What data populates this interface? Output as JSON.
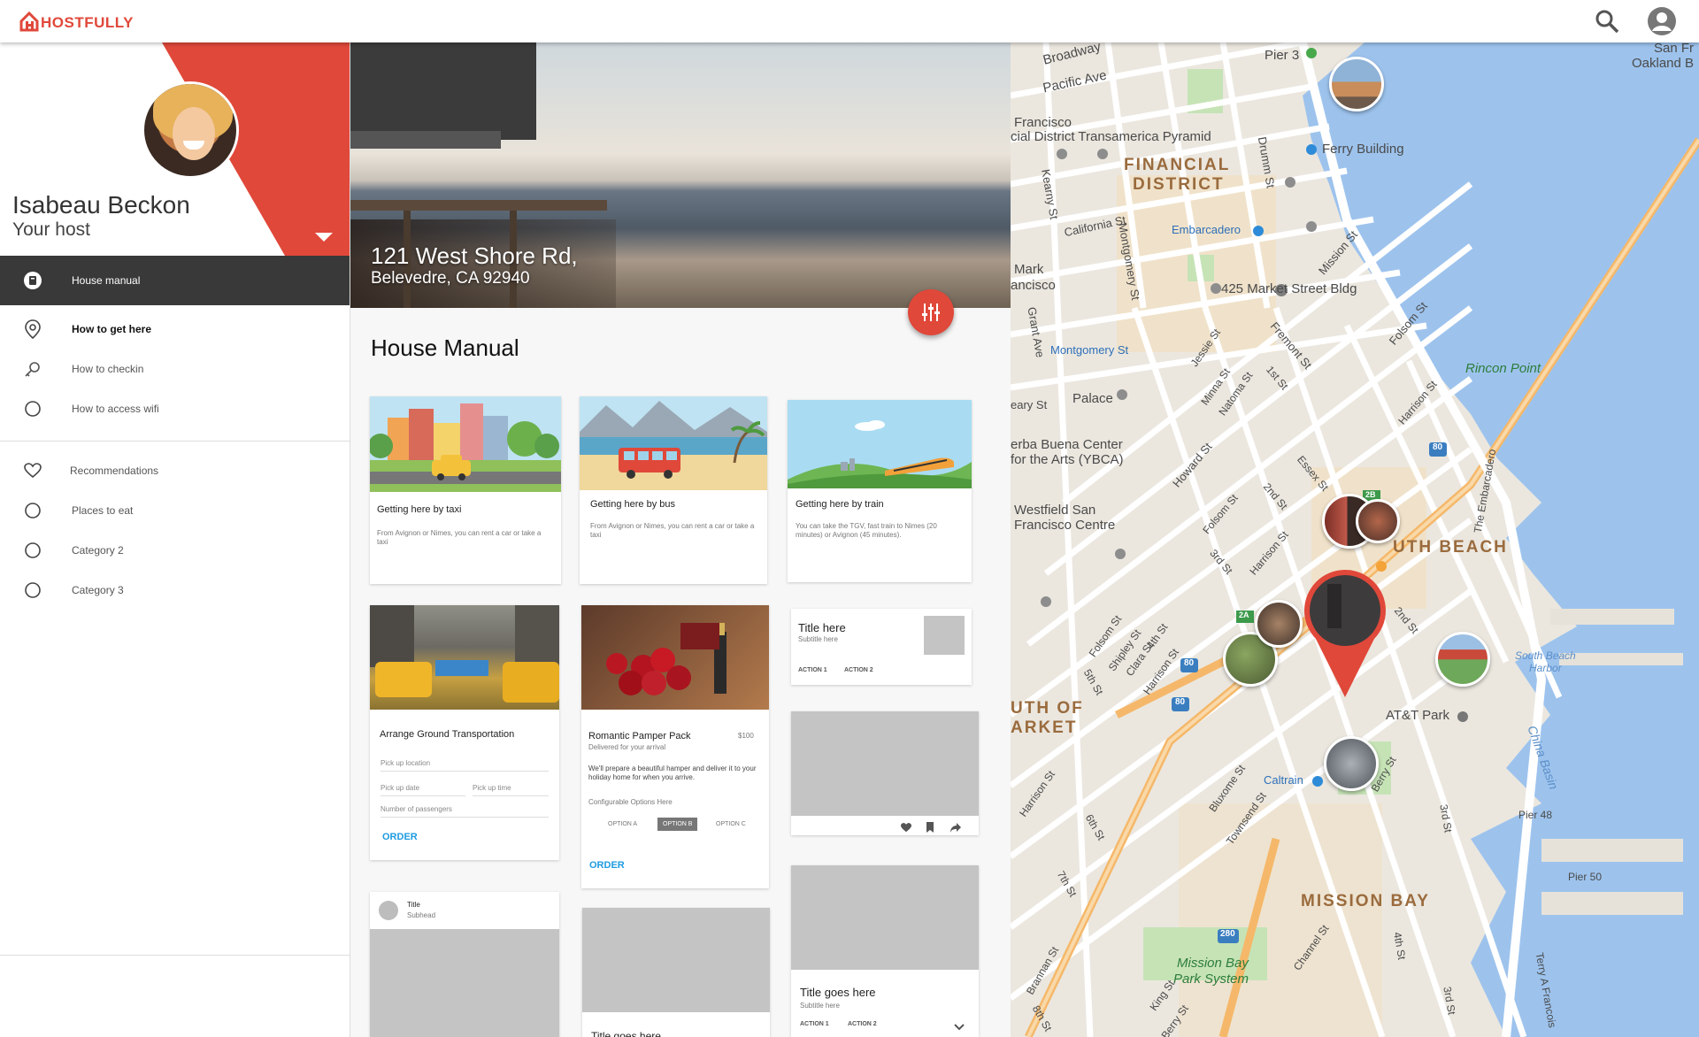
{
  "app": {
    "brand": "HOSTFULLY"
  },
  "host": {
    "name": "Isabeau Beckon",
    "role": "Your host"
  },
  "nav": {
    "items": [
      {
        "label": "House manual"
      },
      {
        "label": "How to get here"
      },
      {
        "label": "How to checkin"
      },
      {
        "label": "How to access wifi"
      },
      {
        "label": "Recommendations"
      },
      {
        "label": "Places to eat"
      },
      {
        "label": "Category 2"
      },
      {
        "label": "Category 3"
      }
    ]
  },
  "hero": {
    "address_line1": "121 West Shore Rd,",
    "address_line2": "Belevedre, CA 92940"
  },
  "main": {
    "section_title": "House Manual"
  },
  "cards": {
    "taxi": {
      "title": "Getting here by taxi",
      "text": "From Avignon or Nimes, you can rent a car or take a taxi"
    },
    "bus": {
      "title": "Getting here by bus",
      "text": "From Avignon or Nimes, you can rent a car or take a taxi"
    },
    "train": {
      "title": "Getting here by train",
      "text": "You can take the TGV, fast train to Nimes (20 minutes) or Avignon (45 minutes)."
    },
    "ground": {
      "title": "Arrange Ground Transportation",
      "pickup_location": "Pick up location",
      "pickup_date": "Pick up date",
      "pickup_time": "Pick up time",
      "passengers": "Number of passengers",
      "order": "ORDER"
    },
    "pamper": {
      "title": "Romantic Pamper Pack",
      "price": "$100",
      "subtitle": "Delivered for your arrival",
      "text": "We'll prepare a beautiful hamper and deliver it to your holiday home for when you arrive.",
      "options_label": "Configurable Options Here",
      "options": [
        "OPTION A",
        "OPTION B",
        "OPTION C"
      ],
      "order": "ORDER"
    },
    "template1": {
      "title": "Title here",
      "subtitle": "Subtitle here",
      "action1": "ACTION 1",
      "action2": "ACTION 2"
    },
    "avatar_card": {
      "title": "Title",
      "subhead": "Subhead"
    },
    "bottom_mid": {
      "title": "Title goes here"
    },
    "template2": {
      "title": "Title goes here",
      "subtitle": "Subtitle here",
      "action1": "ACTION 1",
      "action2": "ACTION 2"
    }
  },
  "map": {
    "labels": {
      "broadway": "Broadway",
      "pacific_ave": "Pacific Ave",
      "pier3": "Pier 3",
      "oakland": "San Fr\nOakland B",
      "francisco": "Francisco",
      "transamerica": "cial District Transamerica Pyramid",
      "ferry": "Ferry Building",
      "financial": "FINANCIAL",
      "district": "DISTRICT",
      "drumm": "Drumm St",
      "california": "California St",
      "embarcadero": "Embarcadero",
      "kearny": "Kearny St",
      "mark": "Mark",
      "ancisco": "ancisco",
      "market425": "425 Market Street Bldg",
      "mission_st": "Mission St",
      "montgomery": "Montgomery St",
      "montgomery_st2": "Montgomery St",
      "grant": "Grant Ave",
      "fremont": "Fremont St",
      "folsom1": "Folsom St",
      "rincon": "Rincon Point",
      "palace": "Palace",
      "eary": "eary St",
      "jessie": "Jessie St",
      "minna": "Minna St",
      "natoma": "Natoma St",
      "first": "1st St",
      "harrison1": "Harrison St",
      "yerba1": "erba Buena Center",
      "yerba2": "for the Arts (YBCA)",
      "howard": "Howard St",
      "essex": "Essex St",
      "embarcadero_rd": "The Embarcadero",
      "westfield1": "Westfield San",
      "westfield2": "Francisco Centre",
      "folsom2": "Folsom St",
      "second": "2nd St",
      "harrison2": "Harrison St",
      "south_beach": "UTH BEACH",
      "third": "3rd St",
      "second2": "2nd St",
      "shipley": "Shipley St",
      "clara": "Clara St",
      "fourth": "4th St",
      "fifth": "5th St",
      "folsom3": "Folsom St",
      "harrison3": "Harrison St",
      "south_beach_harbor": "South Beach\nHarbor",
      "uth_of": "UTH OF",
      "arket": "ARKET",
      "att": "AT&T Park",
      "china_basin": "China Basin",
      "harrison4": "Harrison St",
      "caltrain": "Caltrain",
      "berry1": "Berry St",
      "third2": "3rd St",
      "bluxome": "Bluxome St",
      "townsend": "Townsend St",
      "sixth": "6th St",
      "pier48": "Pier 48",
      "seventh": "7th St",
      "pier50": "Pier 50",
      "mission_bay": "MISSION BAY",
      "channel": "Channel St",
      "fourth2": "4th St",
      "brannan": "Brannan St",
      "mission_bay_park1": "Mission Bay",
      "mission_bay_park2": "Park System",
      "eighth": "8th St",
      "king": "King St",
      "berry2": "Berry St",
      "third3": "3rd St",
      "terry": "Terry A Francois",
      "hwy80a": "80",
      "hwy80b": "80",
      "hwy80c": "80",
      "hwy280": "280",
      "hwy2a": "2A",
      "hwy2b": "2B"
    }
  },
  "colors": {
    "accent": "#e0483a",
    "active_nav": "#393939",
    "link": "#1e9be0"
  }
}
